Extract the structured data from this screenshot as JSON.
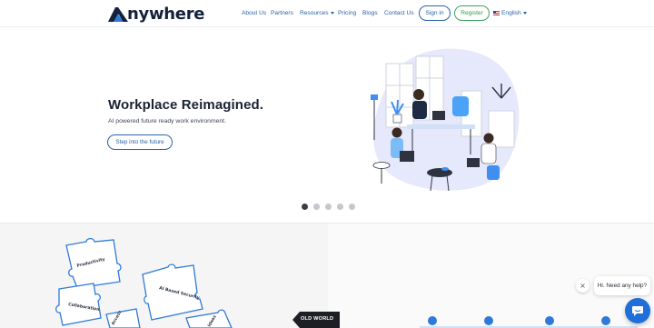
{
  "header": {
    "brand": "nywhere",
    "nav": {
      "about": "About Us",
      "partners": "Partners",
      "resources": "Resources",
      "pricing": "Pricing",
      "blogs": "Blogs",
      "contact": "Contact Us"
    },
    "signin_label": "Sign in",
    "register_label": "Register",
    "language": "English"
  },
  "hero": {
    "title": "Workplace Reimagined.",
    "subtitle": "AI powered future ready work environment.",
    "cta_label": "Step into the future",
    "carousel": {
      "slides": 5,
      "active": 1
    }
  },
  "lower": {
    "puzzle_pieces": [
      "Productivity",
      "Collaboration",
      "AI Based Security",
      "Access",
      "Ideas"
    ],
    "old_world_label": "OLD WORLD"
  },
  "chat": {
    "greeting": "Hi. Need any help?",
    "close_symbol": "×"
  },
  "colors": {
    "brand_navy": "#14213d",
    "link_blue": "#2a63a8",
    "register_green": "#3aa55a",
    "chat_blue": "#1e6fd9",
    "illustration_lavender": "#e6e8fb"
  },
  "icons": {
    "logo": "logo-a-mountain-icon",
    "resources_caret": "chevron-down-icon",
    "language_flag": "us-flag-icon",
    "chat_launcher": "chat-bubble-icon"
  }
}
